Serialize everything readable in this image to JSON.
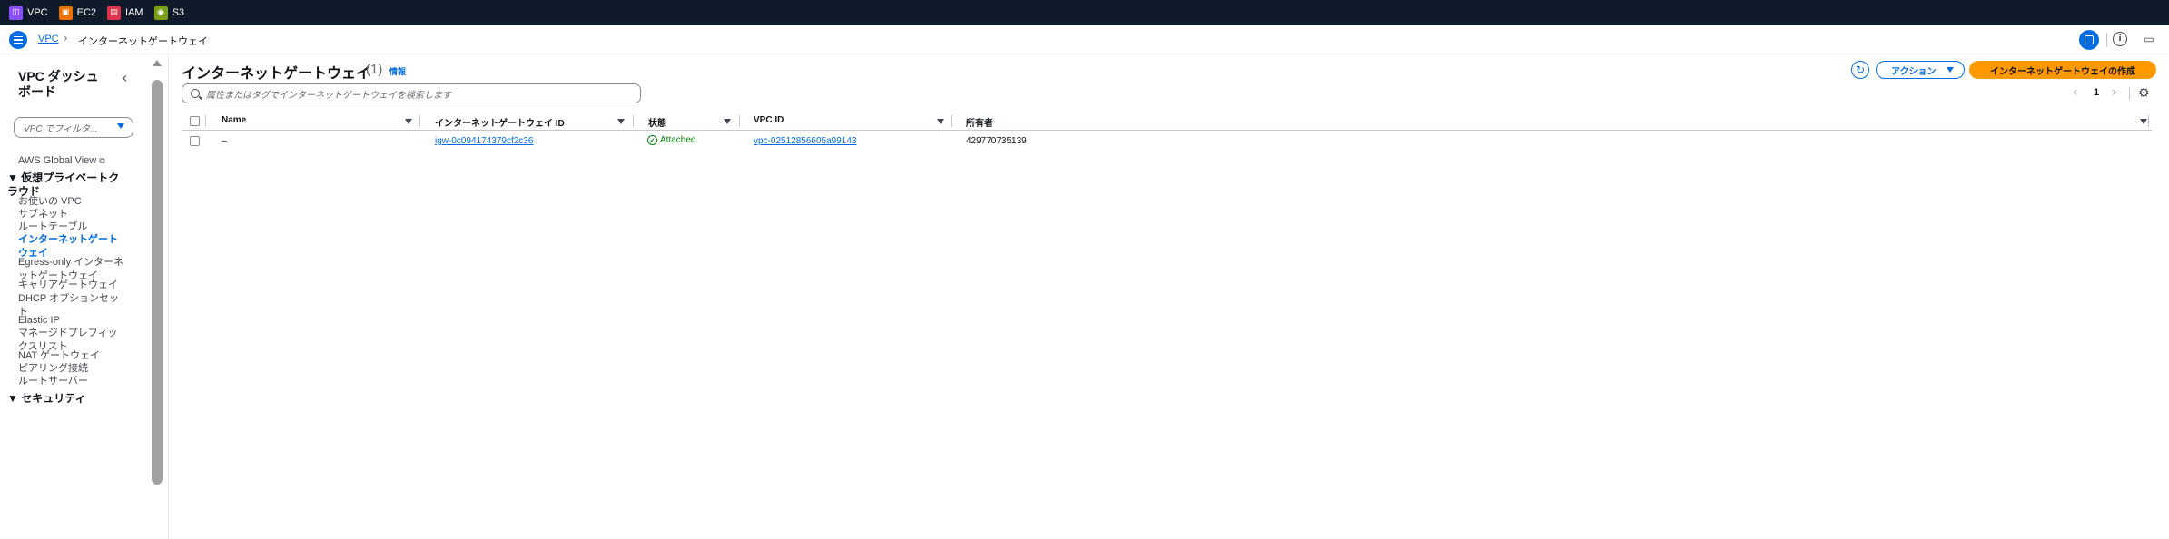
{
  "services": [
    {
      "label": "VPC",
      "icon": "vpc-icon",
      "color": "#8c4fff"
    },
    {
      "label": "EC2",
      "icon": "ec2-icon",
      "color": "#ed7100"
    },
    {
      "label": "IAM",
      "icon": "iam-icon",
      "color": "#dd344c"
    },
    {
      "label": "S3",
      "icon": "s3-icon",
      "color": "#7aa116"
    }
  ],
  "breadcrumb": {
    "root": "VPC",
    "sep": "›",
    "current": "インターネットゲートウェイ"
  },
  "sidebar": {
    "title": "VPC ダッシュボード",
    "filter_placeholder": "VPC でフィルタ...",
    "global_view": "AWS Global View",
    "sections": [
      {
        "label": "▼ 仮想プライベートクラウド"
      },
      {
        "label": "▼ セキュリティ"
      }
    ],
    "items": [
      {
        "label": "お使いの VPC"
      },
      {
        "label": "サブネット"
      },
      {
        "label": "ルートテーブル"
      },
      {
        "label": "インターネットゲートウェイ"
      },
      {
        "label": "Egress-only インターネットゲートウェイ"
      },
      {
        "label": "キャリアゲートウェイ"
      },
      {
        "label": "DHCP オプションセット"
      },
      {
        "label": "Elastic IP"
      },
      {
        "label": "マネージドプレフィックスリスト"
      },
      {
        "label": "NAT ゲートウェイ"
      },
      {
        "label": "ピアリング接続"
      },
      {
        "label": "ルートサーバー"
      }
    ]
  },
  "main": {
    "title": "インターネットゲートウェイ",
    "count": "(1)",
    "info": "情報",
    "actions_label": "アクション",
    "create_label": "インターネットゲートウェイの作成",
    "search_placeholder": "属性またはタグでインターネットゲートウェイを検索します",
    "page": "1"
  },
  "table": {
    "columns": [
      "Name",
      "インターネットゲートウェイ ID",
      "状態",
      "VPC ID",
      "所有者"
    ],
    "rows": [
      {
        "name": "–",
        "igw_id": "igw-0c094174379cf2c36",
        "state": "Attached",
        "vpc_id": "vpc-02512856605a99143",
        "owner": "429770735139"
      }
    ]
  },
  "colors": {
    "accent": "#006ce0",
    "primary_button": "#ff9900",
    "success": "#037f0c",
    "topbar": "#0f1b2a"
  }
}
